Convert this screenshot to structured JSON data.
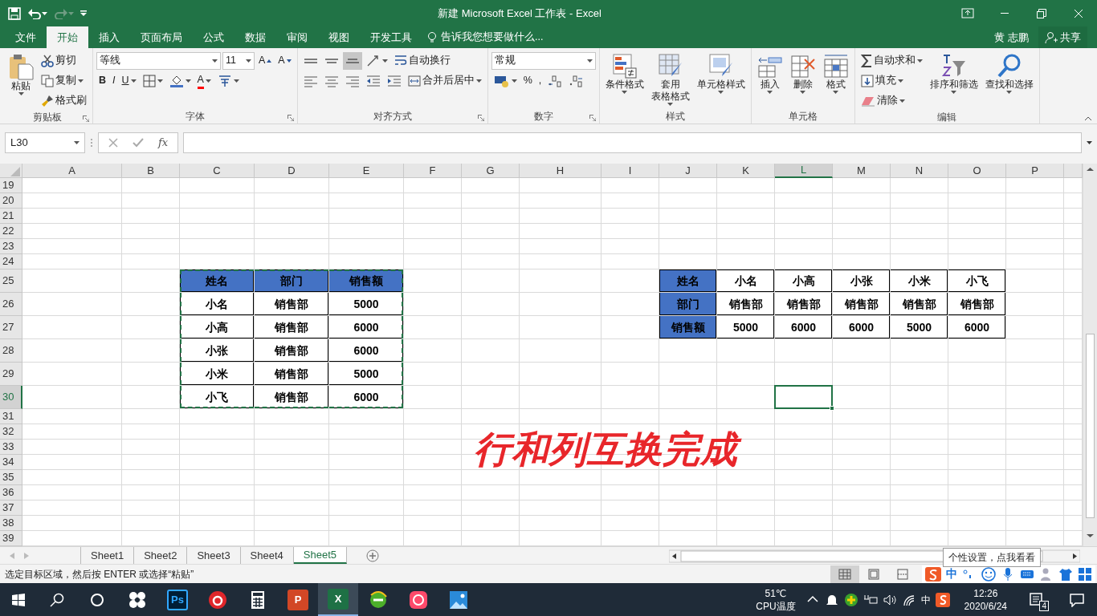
{
  "window": {
    "title": "新建 Microsoft Excel 工作表 - Excel"
  },
  "quick_access": [
    {
      "kind": "save",
      "disabled": false,
      "caret": false
    },
    {
      "kind": "undo",
      "disabled": false,
      "caret": true
    },
    {
      "kind": "redo",
      "disabled": true,
      "caret": true
    },
    {
      "kind": "customize",
      "disabled": false,
      "caret": false
    }
  ],
  "tabs": [
    {
      "label": "文件",
      "selected": false
    },
    {
      "label": "开始",
      "selected": true
    },
    {
      "label": "插入",
      "selected": false
    },
    {
      "label": "页面布局",
      "selected": false
    },
    {
      "label": "公式",
      "selected": false
    },
    {
      "label": "数据",
      "selected": false
    },
    {
      "label": "审阅",
      "selected": false
    },
    {
      "label": "视图",
      "selected": false
    },
    {
      "label": "开发工具",
      "selected": false
    }
  ],
  "tell_me": {
    "placeholder": "告诉我您想要做什么..."
  },
  "user": {
    "name": "黄 志鹏"
  },
  "share": {
    "label": "共享"
  },
  "ribbon": {
    "groups": [
      {
        "label": "剪贴板",
        "launcher": true,
        "columns": [
          {
            "kind": "large",
            "lines": [
              "粘贴"
            ],
            "caret": true
          },
          {
            "kind": "stack",
            "toolbars": [
              {
                "items": [
                  {
                    "kind": "button",
                    "label": "剪切",
                    "caret": false
                  }
                ]
              },
              {
                "items": [
                  {
                    "kind": "button",
                    "label": "复制",
                    "caret": true
                  }
                ]
              },
              {
                "items": [
                  {
                    "kind": "button",
                    "label": "格式刷",
                    "caret": false
                  }
                ]
              }
            ]
          }
        ]
      },
      {
        "label": "字体",
        "launcher": true,
        "columns": [
          {
            "kind": "stack",
            "toolbars": [
              {
                "items": [
                  {
                    "kind": "combo",
                    "value": "等线"
                  },
                  {
                    "kind": "combo",
                    "value": "11"
                  },
                  {
                    "kind": "button",
                    "label": "A",
                    "caret": false
                  },
                  {
                    "kind": "button",
                    "label": "A",
                    "caret": false
                  }
                ]
              },
              {
                "items": [
                  {
                    "kind": "button",
                    "label": "B",
                    "caret": false
                  },
                  {
                    "kind": "button",
                    "label": "I",
                    "caret": false
                  },
                  {
                    "kind": "button",
                    "label": "U",
                    "caret": true
                  },
                  {
                    "kind": "icon",
                    "caret": true
                  },
                  {
                    "kind": "icon",
                    "caret": true
                  },
                  {
                    "kind": "button",
                    "label": "A",
                    "caret": true
                  },
                  {
                    "kind": "icon",
                    "caret": true
                  }
                ]
              }
            ]
          }
        ]
      },
      {
        "label": "对齐方式",
        "launcher": true,
        "columns": [
          {
            "kind": "stack",
            "toolbars": [
              {
                "items": [
                  {
                    "kind": "icon",
                    "caret": false,
                    "selected": false
                  },
                  {
                    "kind": "icon",
                    "caret": false,
                    "selected": false
                  },
                  {
                    "kind": "icon",
                    "caret": false,
                    "selected": true
                  },
                  {
                    "kind": "icon",
                    "caret": true
                  },
                  {
                    "kind": "button",
                    "label": "自动换行",
                    "caret": false
                  }
                ]
              },
              {
                "items": [
                  {
                    "kind": "icon",
                    "caret": false,
                    "selected": false
                  },
                  {
                    "kind": "icon",
                    "caret": false,
                    "selected": false
                  },
                  {
                    "kind": "icon",
                    "caret": false,
                    "selected": false
                  },
                  {
                    "kind": "icon",
                    "caret": false
                  },
                  {
                    "kind": "icon",
                    "caret": false
                  },
                  {
                    "kind": "button",
                    "label": "合并后居中",
                    "caret": true
                  }
                ]
              }
            ]
          }
        ]
      },
      {
        "label": "数字",
        "launcher": true,
        "columns": [
          {
            "kind": "stack",
            "toolbars": [
              {
                "items": [
                  {
                    "kind": "combo",
                    "value": "常规"
                  }
                ]
              },
              {
                "items": [
                  {
                    "kind": "icon",
                    "caret": true
                  },
                  {
                    "kind": "button",
                    "label": "%",
                    "caret": false
                  },
                  {
                    "kind": "button",
                    "label": ",",
                    "caret": false
                  },
                  {
                    "kind": "icon",
                    "caret": false
                  },
                  {
                    "kind": "icon",
                    "caret": false
                  }
                ]
              }
            ]
          }
        ]
      },
      {
        "label": "样式",
        "launcher": false,
        "columns": [
          {
            "kind": "large",
            "lines": [
              "条件格式"
            ],
            "caret": true
          },
          {
            "kind": "large",
            "lines": [
              "套用",
              "表格格式"
            ],
            "caret": true
          },
          {
            "kind": "large",
            "lines": [
              "单元格样式"
            ],
            "caret": true
          }
        ]
      },
      {
        "label": "单元格",
        "launcher": false,
        "columns": [
          {
            "kind": "large",
            "lines": [
              "插入"
            ],
            "caret": true
          },
          {
            "kind": "large",
            "lines": [
              "删除"
            ],
            "caret": true
          },
          {
            "kind": "large",
            "lines": [
              "格式"
            ],
            "caret": true
          }
        ]
      },
      {
        "label": "编辑",
        "launcher": false,
        "columns": [
          {
            "kind": "stack",
            "toolbars": [
              {
                "items": [
                  {
                    "kind": "button",
                    "label": "自动求和",
                    "caret": true
                  }
                ]
              },
              {
                "items": [
                  {
                    "kind": "button",
                    "label": "填充",
                    "caret": true
                  }
                ]
              },
              {
                "items": [
                  {
                    "kind": "button",
                    "label": "清除",
                    "caret": true
                  }
                ]
              }
            ]
          },
          {
            "kind": "large",
            "lines": [
              "排序和筛选"
            ],
            "caret": true
          },
          {
            "kind": "large",
            "lines": [
              "查找和选择"
            ],
            "caret": true
          }
        ]
      }
    ]
  },
  "formula_bar": {
    "name_box": "L30",
    "function_label": "fx"
  },
  "sheet": {
    "columns": [
      {
        "label": "A",
        "selected": false
      },
      {
        "label": "B",
        "selected": false
      },
      {
        "label": "C",
        "selected": false
      },
      {
        "label": "D",
        "selected": false
      },
      {
        "label": "E",
        "selected": false
      },
      {
        "label": "F",
        "selected": false
      },
      {
        "label": "G",
        "selected": false
      },
      {
        "label": "H",
        "selected": false
      },
      {
        "label": "I",
        "selected": false
      },
      {
        "label": "J",
        "selected": false
      },
      {
        "label": "K",
        "selected": false
      },
      {
        "label": "L",
        "selected": true
      },
      {
        "label": "M",
        "selected": false
      },
      {
        "label": "N",
        "selected": false
      },
      {
        "label": "O",
        "selected": false
      },
      {
        "label": "P",
        "selected": false
      }
    ],
    "rows": [
      {
        "number": "19",
        "selected": false
      },
      {
        "number": "20",
        "selected": false
      },
      {
        "number": "21",
        "selected": false
      },
      {
        "number": "22",
        "selected": false
      },
      {
        "number": "23",
        "selected": false
      },
      {
        "number": "24",
        "selected": false
      },
      {
        "number": "25",
        "selected": false
      },
      {
        "number": "26",
        "selected": false
      },
      {
        "number": "27",
        "selected": false
      },
      {
        "number": "28",
        "selected": false
      },
      {
        "number": "29",
        "selected": false
      },
      {
        "number": "30",
        "selected": true
      },
      {
        "number": "31",
        "selected": false
      },
      {
        "number": "32",
        "selected": false
      },
      {
        "number": "33",
        "selected": false
      },
      {
        "number": "34",
        "selected": false
      },
      {
        "number": "35",
        "selected": false
      },
      {
        "number": "36",
        "selected": false
      },
      {
        "number": "37",
        "selected": false
      },
      {
        "number": "38",
        "selected": false
      },
      {
        "number": "39",
        "selected": false
      }
    ],
    "tables": [
      {
        "kind": "vertical",
        "copied": true,
        "rows": [
          [
            "姓名",
            "部门",
            "销售额"
          ],
          [
            "小名",
            "销售部",
            "5000"
          ],
          [
            "小高",
            "销售部",
            "6000"
          ],
          [
            "小张",
            "销售部",
            "6000"
          ],
          [
            "小米",
            "销售部",
            "5000"
          ],
          [
            "小飞",
            "销售部",
            "6000"
          ]
        ]
      },
      {
        "kind": "horizontal",
        "copied": false,
        "rows": [
          [
            "姓名",
            "小名",
            "小高",
            "小张",
            "小米",
            "小飞"
          ],
          [
            "部门",
            "销售部",
            "销售部",
            "销售部",
            "销售部",
            "销售部"
          ],
          [
            "销售额",
            "5000",
            "6000",
            "6000",
            "5000",
            "6000"
          ]
        ]
      }
    ],
    "annotation": "行和列互换完成"
  },
  "sheet_tabs": [
    {
      "label": "Sheet1",
      "selected": false
    },
    {
      "label": "Sheet2",
      "selected": false
    },
    {
      "label": "Sheet3",
      "selected": false
    },
    {
      "label": "Sheet4",
      "selected": false
    },
    {
      "label": "Sheet5",
      "selected": true
    }
  ],
  "status_bar": {
    "message": "选定目标区域，然后按 ENTER 或选择“粘贴”",
    "views": [
      {
        "selected": true
      },
      {
        "selected": false
      },
      {
        "selected": false
      }
    ]
  },
  "ime_toolbar": {
    "mode": "中",
    "tooltip": "个性设置，点我看看"
  },
  "taskbar": {
    "apps": [
      {
        "selected": false
      },
      {
        "selected": false,
        "label": "Ps"
      },
      {
        "selected": false
      },
      {
        "selected": false
      },
      {
        "selected": false,
        "label": "P"
      },
      {
        "selected": true,
        "label": "X"
      },
      {
        "selected": false
      },
      {
        "selected": false
      },
      {
        "selected": false
      }
    ],
    "temperature": "51℃",
    "temperature_label": "CPU温度",
    "input_mode": "中",
    "time": "12:26",
    "date": "2020/6/24",
    "notifications": "4"
  }
}
